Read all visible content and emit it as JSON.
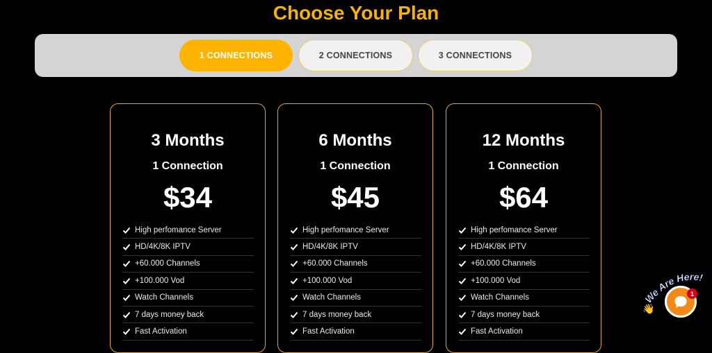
{
  "page": {
    "title": "Choose Your Plan"
  },
  "tabs": [
    {
      "label": "1 CONNECTIONS",
      "active": true
    },
    {
      "label": "2 CONNECTIONS",
      "active": false
    },
    {
      "label": "3 CONNECTIONS",
      "active": false
    }
  ],
  "plans": [
    {
      "duration": "3 Months",
      "connections": "1 Connection",
      "price": "$34",
      "features": [
        "High perfomance Server",
        "HD/4K/8K IPTV",
        "+60.000 Channels",
        "+100.000 Vod",
        "Watch Channels",
        "7 days money back",
        "Fast Activation"
      ]
    },
    {
      "duration": "6 Months",
      "connections": "1 Connection",
      "price": "$45",
      "features": [
        "High perfomance Server",
        "HD/4K/8K IPTV",
        "+60.000 Channels",
        "+100.000 Vod",
        "Watch Channels",
        "7 days money back",
        "Fast Activation"
      ]
    },
    {
      "duration": "12 Months",
      "connections": "1 Connection",
      "price": "$64",
      "features": [
        "High perfomance Server",
        "HD/4K/8K IPTV",
        "+60.000 Channels",
        "+100.000 Vod",
        "Watch Channels",
        "7 days money back",
        "Fast Activation"
      ]
    }
  ],
  "chat": {
    "tagline": "We Are Here!",
    "badge_count": "1",
    "icons": [
      "chat-icon",
      "wave-hand-icon"
    ]
  },
  "colors": {
    "accent": "#f5b30a",
    "tab_active": "#fcb400",
    "card_border": "#e8a73a",
    "chat": "#f28a1a"
  }
}
